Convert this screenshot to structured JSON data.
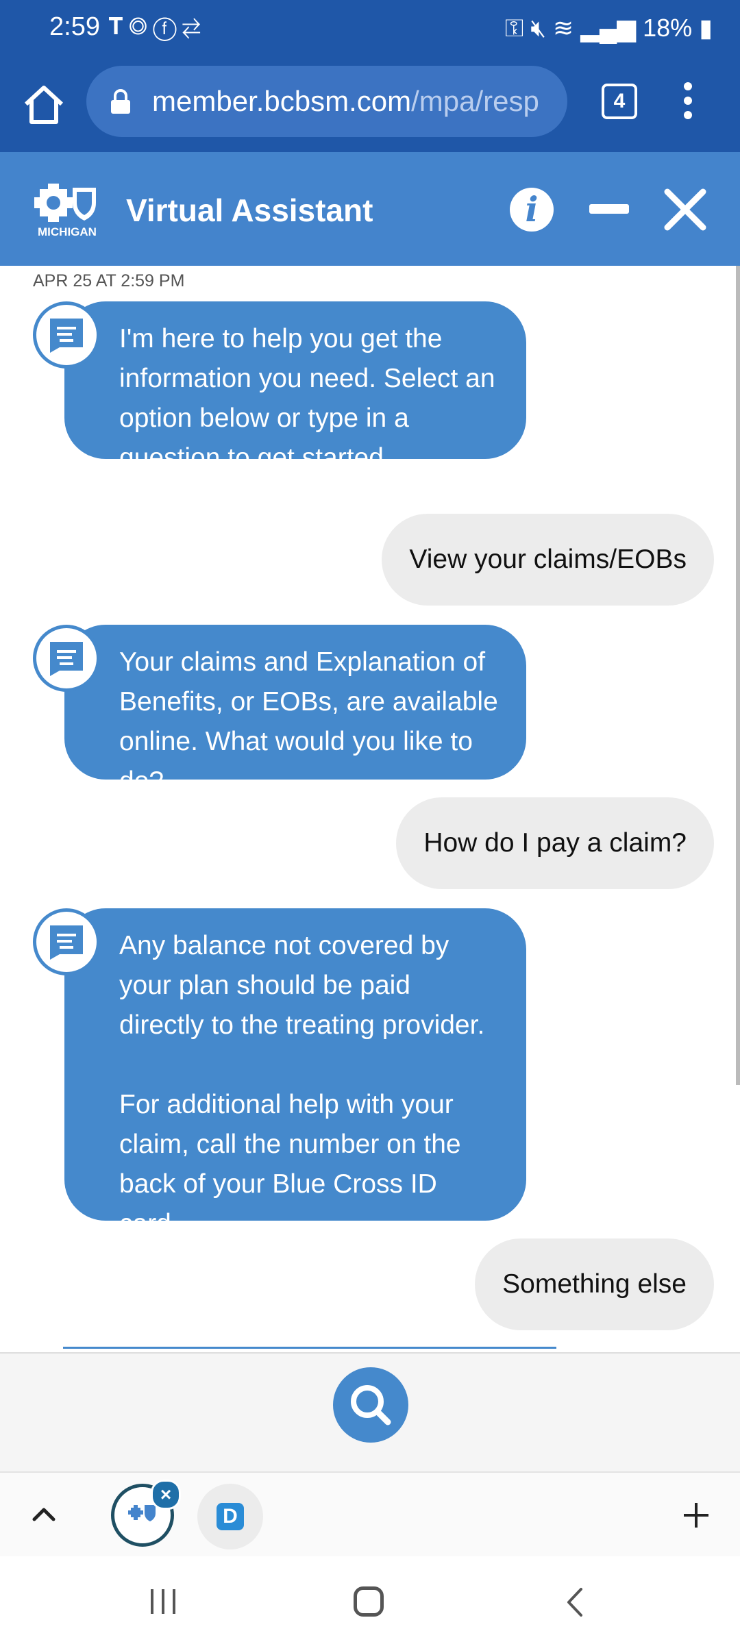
{
  "status_bar": {
    "time": "2:59",
    "left_icons": [
      "t-mobile-icon",
      "shazam-icon",
      "facebook-icon",
      "swap-icon"
    ],
    "battery": "18%",
    "right_icons": [
      "key-icon",
      "mute-icon",
      "wifi-icon",
      "signal-icon",
      "battery-charging-icon"
    ]
  },
  "browser": {
    "url_host": "member.bcbsm.com",
    "url_path": "/mpa/resp",
    "tab_count": "4"
  },
  "header": {
    "logo_text": "MICHIGAN",
    "title": "Virtual Assistant"
  },
  "chat": {
    "timestamp": "APR 25 AT 2:59 PM",
    "messages": [
      {
        "from": "bot",
        "text": "I'm here to help you get the information you need. Select an option below or type in a question to get started."
      },
      {
        "from": "user",
        "text": "View your claims/EOBs"
      },
      {
        "from": "bot",
        "text": "Your claims and Explanation of Benefits, or EOBs, are available online. What would you like to do?"
      },
      {
        "from": "user",
        "text": "How do I pay a claim?"
      },
      {
        "from": "bot",
        "text": "Any balance not covered by your plan should be paid directly to the treating provider."
      },
      {
        "from": "bot",
        "text": "For additional help with your claim, call the number on the back of your Blue Cross ID card."
      },
      {
        "from": "user",
        "text": "Something else"
      }
    ]
  },
  "dock": {
    "tab2_letter": "D"
  },
  "colors": {
    "status_bg": "#1f57a8",
    "header_bg": "#4484cc",
    "bot_bubble": "#4589cc",
    "user_bubble": "#ececec"
  }
}
